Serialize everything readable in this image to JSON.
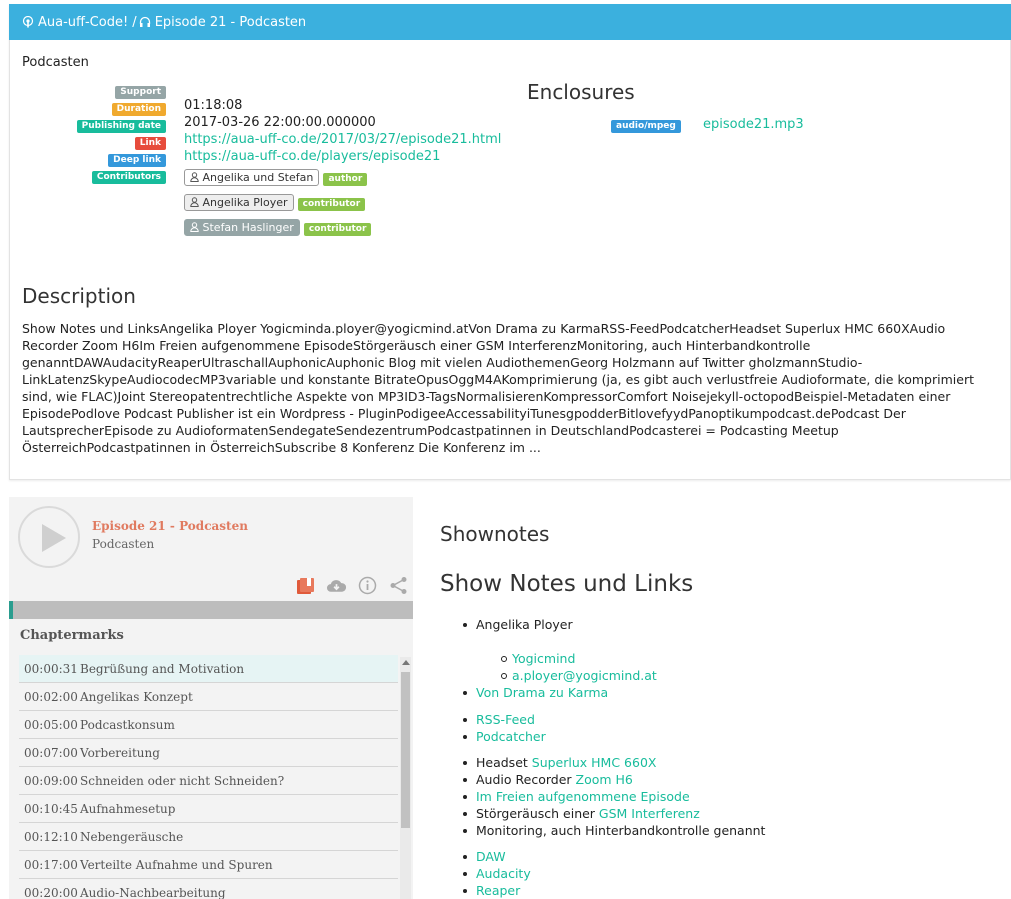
{
  "header": {
    "title": "Aua-uff-Code! / ",
    "episode": "Episode 21 - Podcasten"
  },
  "section_label": "Podcasten",
  "meta": {
    "labels": {
      "support": "Support",
      "duration": "Duration",
      "publishing_date": "Publishing date",
      "link": "Link",
      "deep_link": "Deep link",
      "contributors": "Contributors"
    },
    "duration": "01:18:08",
    "publishing_date": "2017-03-26 22:00:00.000000",
    "link": "https://aua-uff-co.de/2017/03/27/episode21.html",
    "deep_link": "https://aua-uff-co.de/players/episode21",
    "contributors": [
      {
        "name": "Angelika und Stefan",
        "role": "author"
      },
      {
        "name": "Angelika Ployer",
        "role": "contributor"
      },
      {
        "name": "Stefan Haslinger",
        "role": "contributor"
      }
    ]
  },
  "enclosures": {
    "title": "Enclosures",
    "type": "audio/mpeg",
    "file": "episode21.mp3"
  },
  "description": {
    "title": "Description",
    "text": "Show Notes und LinksAngelika Ployer Yogicminda.ployer@yogicmind.atVon Drama zu KarmaRSS-FeedPodcatcherHeadset Superlux HMC 660XAudio Recorder Zoom H6Im Freien aufgenommene EpisodeStörgeräusch einer GSM InterferenzMonitoring, auch Hinterbandkontrolle genanntDAWAudacityReaperUltraschallAuphonicAuphonic Blog mit vielen AudiothemenGeorg Holzmann auf Twitter gholzmannStudio-LinkLatenzSkypeAudiocodecMP3variable und konstante BitrateOpusOggM4AKomprimierung (ja, es gibt auch verlustfreie Audioformate, die komprimiert sind, wie FLAC)Joint Stereopatentrechtliche Aspekte von MP3ID3-TagsNormalisierenKompressorComfort Noisejekyll-octopodBeispiel-Metadaten einer EpisodePodlove Podcast Publisher ist ein Wordpress - PluginPodigeeAccessabilityiTunesgpodderBitlovefyydPanoptikumpodcast.dePodcast Der LautsprecherEpisode zu AudioformatenSendegateSendezentrumPodcastpatinnen in DeutschlandPodcasterei = Podcasting Meetup ÖsterreichPodcastpatinnen in ÖsterreichSubscribe 8 Konferenz Die Konferenz im ..."
  },
  "player": {
    "title": "Episode 21 - Podcasten",
    "subtitle": "Podcasten",
    "progress": 0.01,
    "chaptermarks_title": "Chaptermarks",
    "chapters": [
      {
        "time": "00:00:31",
        "title": "Begrüßung and Motivation"
      },
      {
        "time": "00:02:00",
        "title": "Angelikas Konzept"
      },
      {
        "time": "00:05:00",
        "title": "Podcastkonsum"
      },
      {
        "time": "00:07:00",
        "title": "Vorbereitung"
      },
      {
        "time": "00:09:00",
        "title": "Schneiden oder nicht Schneiden?"
      },
      {
        "time": "00:10:45",
        "title": "Aufnahmesetup"
      },
      {
        "time": "00:12:10",
        "title": "Nebengeräusche"
      },
      {
        "time": "00:17:00",
        "title": "Verteilte Aufnahme und Spuren"
      },
      {
        "time": "00:20:00",
        "title": "Audio-Nachbearbeitung"
      }
    ]
  },
  "shownotes": {
    "title": "Shownotes",
    "heading": "Show Notes und Links",
    "angelika": "Angelika Ployer",
    "yogicmind": "Yogicmind",
    "email": "a.ployer@yogicmind.at",
    "drama": "Von Drama zu Karma",
    "rss": "RSS-Feed",
    "podcatcher": "Podcatcher",
    "headset_label": "Headset ",
    "headset_link": "Superlux HMC 660X",
    "recorder_label": "Audio Recorder ",
    "recorder_link": "Zoom H6",
    "outdoor": "Im Freien aufgenommene Episode",
    "noise_label": "Störgeräusch einer ",
    "noise_link": "GSM Interferenz",
    "monitoring": "Monitoring, auch Hinterbandkontrolle genannt",
    "daw": "DAW",
    "audacity": "Audacity",
    "reaper": "Reaper"
  },
  "colors": {
    "header_bg": "#3bb0de",
    "link": "#18bc9c",
    "player_title": "#e07a5f"
  }
}
